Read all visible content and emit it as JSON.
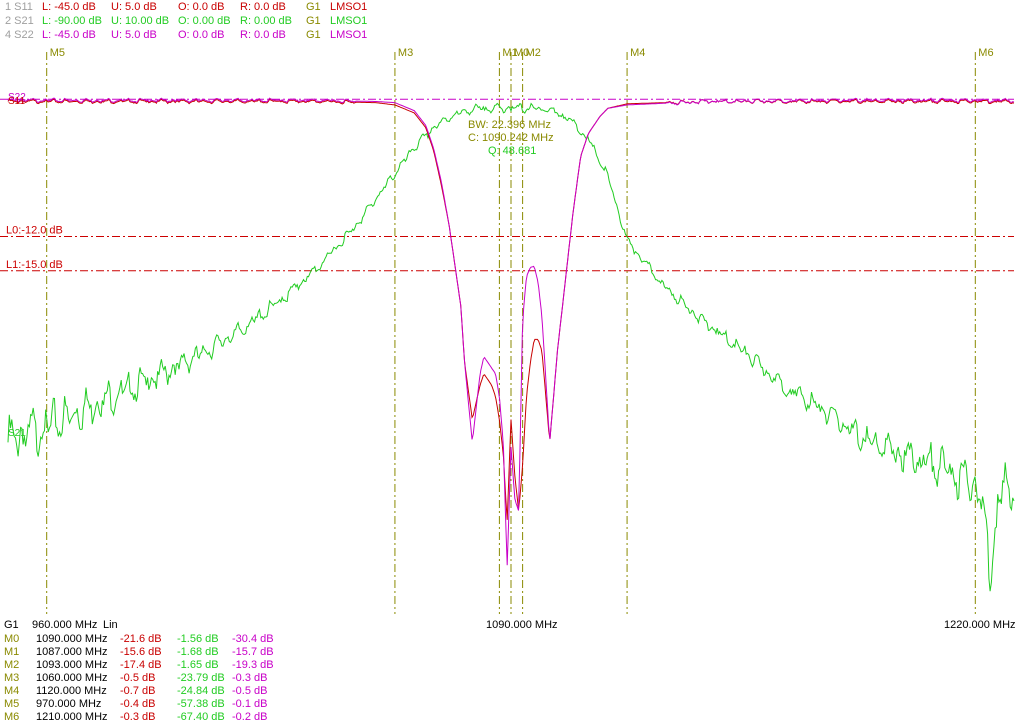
{
  "colors": {
    "s11": "#c80000",
    "s21": "#22cc22",
    "s22": "#c800c8",
    "marker": "#8a8a00",
    "limit": "#cc0000",
    "gray": "#a0a0a0",
    "text": "#000000"
  },
  "header_rows": [
    {
      "id": "1 S11",
      "l": "L: -45.0 dB",
      "u": "U:  5.0 dB",
      "o": "O:  0.0 dB",
      "r": "R:  0.0 dB",
      "g": "G1",
      "mode": "LMSO1",
      "color": "#c80000"
    },
    {
      "id": "2 S21",
      "l": "L: -90.00 dB",
      "u": "U: 10.00 dB",
      "o": "O:  0.00 dB",
      "r": "R:  0.00 dB",
      "g": "G1",
      "mode": "LMSO1",
      "color": "#22cc22"
    },
    {
      "id": "4 S22",
      "l": "L: -45.0 dB",
      "u": "U:  5.0 dB",
      "o": "O:  0.0 dB",
      "r": "R:  0.0 dB",
      "g": "G1",
      "mode": "LMSO1",
      "color": "#c800c8"
    }
  ],
  "chart_data": {
    "type": "line",
    "x_axis": {
      "start_mhz": 960,
      "stop_mhz": 1220,
      "scale": "Lin",
      "ticks": [
        "960.000 MHz",
        "1090.000 MHz",
        "1220.000 MHz"
      ],
      "scale_label": "Lin",
      "group_label": "G1"
    },
    "axes": {
      "s11": {
        "ylim": [
          -45,
          5
        ]
      },
      "s21": {
        "ylim": [
          -90,
          10
        ]
      },
      "s22": {
        "ylim": [
          -45,
          5
        ]
      }
    },
    "trace_labels": {
      "s11": "S11",
      "s21": "S21",
      "s22": "S22"
    },
    "series": [
      {
        "name": "S11",
        "x": [
          960,
          1000,
          1040,
          1055,
          1060,
          1065,
          1068,
          1070,
          1072,
          1074,
          1077,
          1078,
          1080,
          1082,
          1083,
          1085,
          1086,
          1087,
          1088,
          1089,
          1090,
          1091,
          1092,
          1093,
          1094,
          1095,
          1096,
          1097,
          1098,
          1100,
          1102,
          1104,
          1106,
          1108,
          1110,
          1113,
          1115,
          1120,
          1140,
          1180,
          1220
        ],
        "y": [
          -0.2,
          -0.2,
          -0.2,
          -0.3,
          -0.5,
          -1.2,
          -2.5,
          -4.5,
          -7.5,
          -11,
          -18,
          -23,
          -28,
          -25,
          -24,
          -25,
          -26,
          -28,
          -31,
          -37,
          -28,
          -33,
          -36,
          -32,
          -26,
          -23,
          -21,
          -21,
          -22,
          -30,
          -22,
          -16,
          -10,
          -5,
          -3,
          -1.5,
          -0.8,
          -0.4,
          -0.2,
          -0.2,
          -0.2
        ]
      },
      {
        "name": "S21",
        "x": [
          960,
          965,
          970,
          980,
          990,
          1000,
          1010,
          1020,
          1030,
          1040,
          1050,
          1055,
          1060,
          1065,
          1070,
          1075,
          1080,
          1085,
          1090,
          1095,
          1100,
          1105,
          1110,
          1115,
          1120,
          1130,
          1140,
          1150,
          1160,
          1170,
          1180,
          1190,
          1200,
          1210,
          1212,
          1214,
          1216,
          1218,
          1220
        ],
        "y": [
          -60,
          -58.5,
          -57.4,
          -54,
          -51,
          -48,
          -44.5,
          -40.5,
          -35.5,
          -29.5,
          -22,
          -17.5,
          -13,
          -8.5,
          -5,
          -2.8,
          -1.8,
          -1.6,
          -1.56,
          -1.6,
          -1.8,
          -3.5,
          -7,
          -13.5,
          -24.8,
          -33,
          -39,
          -44,
          -50,
          -54,
          -59,
          -62,
          -64,
          -67.4,
          -72,
          -82,
          -70,
          -68,
          -66
        ]
      },
      {
        "name": "S22",
        "x": [
          960,
          1000,
          1040,
          1055,
          1060,
          1065,
          1068,
          1070,
          1072,
          1074,
          1077,
          1078,
          1080,
          1082,
          1083,
          1085,
          1086,
          1087,
          1088,
          1089,
          1090,
          1091,
          1092,
          1093,
          1094,
          1095,
          1096,
          1097,
          1098,
          1100,
          1102,
          1104,
          1106,
          1108,
          1110,
          1113,
          1115,
          1120,
          1140,
          1180,
          1220
        ],
        "y": [
          -0.1,
          -0.1,
          -0.1,
          -0.2,
          -0.3,
          -1.0,
          -2.3,
          -4.3,
          -7.2,
          -11,
          -18,
          -23,
          -30,
          -24,
          -22.5,
          -23.5,
          -24,
          -26,
          -30,
          -41,
          -30.4,
          -35,
          -36,
          -19.3,
          -15.5,
          -14.7,
          -14.6,
          -16,
          -19,
          -30,
          -22,
          -16,
          -10,
          -5,
          -3,
          -1.5,
          -0.8,
          -0.5,
          -0.2,
          -0.1,
          -0.1
        ]
      }
    ],
    "limit_lines": [
      {
        "label": "L0:-12.0 dB",
        "value": -12.0
      },
      {
        "label": "L1:-15.0 dB",
        "value": -15.0
      }
    ],
    "markers": [
      {
        "name": "M5",
        "freq": 970
      },
      {
        "name": "M3",
        "freq": 1060
      },
      {
        "name": "M1",
        "freq": 1087
      },
      {
        "name": "M0",
        "freq": 1090
      },
      {
        "name": "M2",
        "freq": 1093
      },
      {
        "name": "M4",
        "freq": 1120
      },
      {
        "name": "M6",
        "freq": 1210
      }
    ],
    "bandwidth": {
      "bw": "BW:  22.396 MHz",
      "center": "C: 1090.242 MHz",
      "q": "Q:  48.681"
    }
  },
  "marker_table": [
    {
      "name": "M0",
      "freq": "1090.000 MHz",
      "s11": "-21.6 dB",
      "s21": "-1.56 dB",
      "s22": "-30.4 dB"
    },
    {
      "name": "M1",
      "freq": "1087.000 MHz",
      "s11": "-15.6 dB",
      "s21": "-1.68 dB",
      "s22": "-15.7 dB"
    },
    {
      "name": "M2",
      "freq": "1093.000 MHz",
      "s11": "-17.4 dB",
      "s21": "-1.65 dB",
      "s22": "-19.3 dB"
    },
    {
      "name": "M3",
      "freq": "1060.000 MHz",
      "s11": "-0.5 dB",
      "s21": "-23.79 dB",
      "s22": "-0.3 dB"
    },
    {
      "name": "M4",
      "freq": "1120.000 MHz",
      "s11": "-0.7 dB",
      "s21": "-24.84 dB",
      "s22": "-0.5 dB"
    },
    {
      "name": "M5",
      "freq": "970.000 MHz",
      "s11": "-0.4 dB",
      "s21": "-57.38 dB",
      "s22": "-0.1 dB"
    },
    {
      "name": "M6",
      "freq": "1210.000 MHz",
      "s11": "-0.3 dB",
      "s21": "-67.40 dB",
      "s22": "-0.2 dB"
    }
  ]
}
